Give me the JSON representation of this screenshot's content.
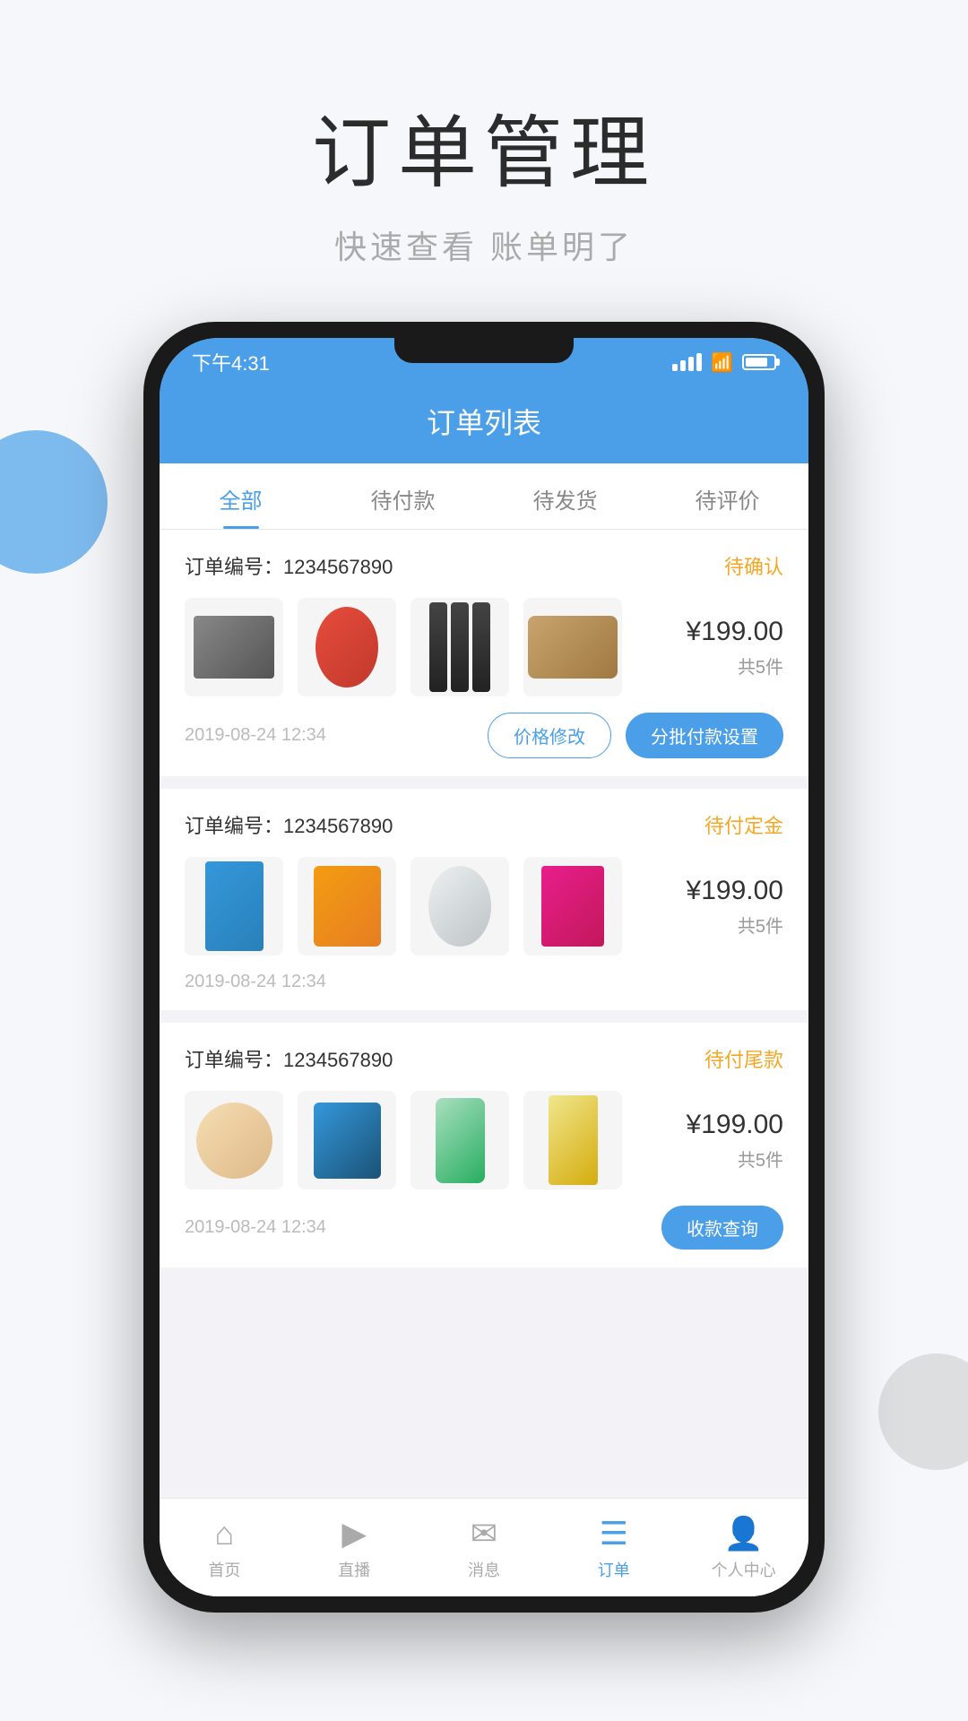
{
  "page": {
    "title": "订单管理",
    "subtitle": "快速查看 账单明了"
  },
  "status_bar": {
    "time": "下午4:31"
  },
  "app_header": {
    "title": "订单列表"
  },
  "tabs": [
    {
      "label": "全部",
      "active": true
    },
    {
      "label": "待付款",
      "active": false
    },
    {
      "label": "待发货",
      "active": false
    },
    {
      "label": "待评价",
      "active": false
    }
  ],
  "orders": [
    {
      "id": "order-1",
      "number_label": "订单编号：1234567890",
      "status": "待确认",
      "status_class": "status-pending-confirm",
      "price": "¥199.00",
      "count": "共5件",
      "date": "2019-08-24 12:34",
      "actions": [
        {
          "label": "价格修改",
          "type": "outline"
        },
        {
          "label": "分批付款设置",
          "type": "solid"
        }
      ]
    },
    {
      "id": "order-2",
      "number_label": "订单编号：1234567890",
      "status": "待付定金",
      "status_class": "status-pending-deposit",
      "price": "¥199.00",
      "count": "共5件",
      "date": "2019-08-24 12:34",
      "actions": []
    },
    {
      "id": "order-3",
      "number_label": "订单编号：1234567890",
      "status": "待付尾款",
      "status_class": "status-pending-balance",
      "price": "¥199.00",
      "count": "共5件",
      "date": "2019-08-24 12:34",
      "actions": [
        {
          "label": "收款查询",
          "type": "solid"
        }
      ]
    }
  ],
  "bottom_nav": [
    {
      "label": "首页",
      "icon": "🏠",
      "active": false
    },
    {
      "label": "直播",
      "icon": "📺",
      "active": false
    },
    {
      "label": "消息",
      "icon": "💬",
      "active": false
    },
    {
      "label": "订单",
      "icon": "📋",
      "active": true
    },
    {
      "label": "个人中心",
      "icon": "👤",
      "active": false
    }
  ]
}
